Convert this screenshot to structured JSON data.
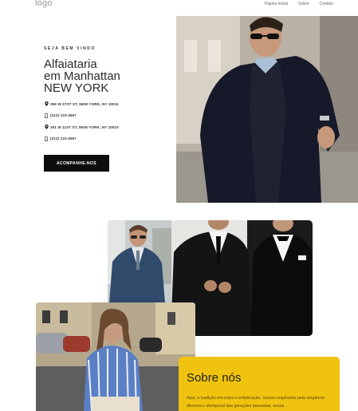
{
  "header": {
    "logo": "logo",
    "nav": [
      "Página inicial",
      "Sobre",
      "Contato"
    ]
  },
  "hero": {
    "welcome": "SEJA BEM VINDO",
    "title_lines": [
      "Alfaiataria",
      "em Manhattan",
      "NEW YORK"
    ],
    "contacts": [
      {
        "icon": "location-pin-icon",
        "text": "256 W 27ST ST, NEW YORK, NY 10011"
      },
      {
        "icon": "phone-icon",
        "text": "(212) 123-4567"
      },
      {
        "icon": "location-pin-icon",
        "text": "301 W 11ST ST, NEW YORK, NY 10023"
      },
      {
        "icon": "phone-icon",
        "text": "(212) 123-4567"
      }
    ],
    "cta_label": "ACOMPANHE-NOS"
  },
  "about": {
    "title": "Sobre nós",
    "text": "Aqui, a tradição encontra a sofisticação. Somos inspirados pela elegância discreta e atemporal das gerações passadas, nossa"
  },
  "colors": {
    "accent_yellow": "#f0c30f",
    "button_black": "#0d0d0d"
  }
}
